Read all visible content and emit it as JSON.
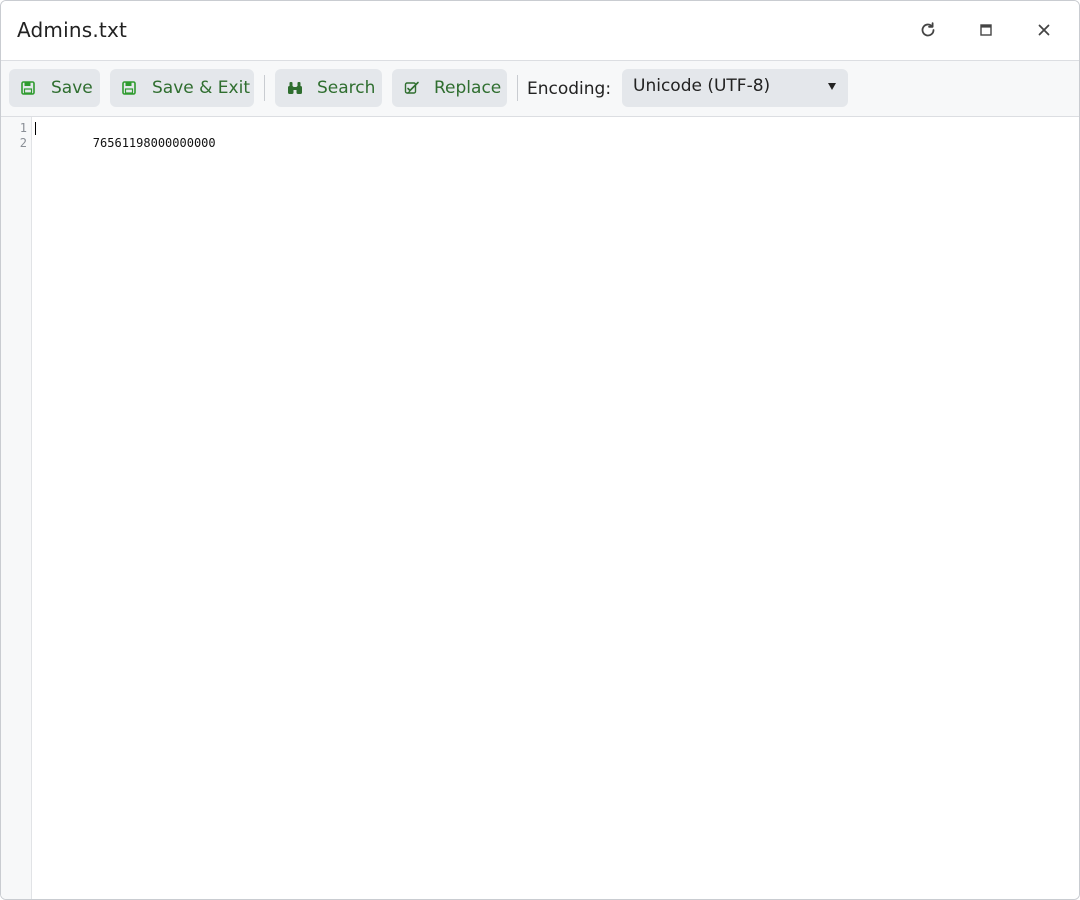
{
  "window": {
    "title": "Admins.txt",
    "controls": [
      "refresh-icon",
      "maximize-icon",
      "close-icon"
    ]
  },
  "toolbar": {
    "save_label": "Save",
    "save_exit_label": "Save & Exit",
    "search_label": "Search",
    "replace_label": "Replace",
    "encoding_label": "Encoding:",
    "encoding_value": "Unicode (UTF-8)",
    "accent_color": "#2f6e2f"
  },
  "editor": {
    "line_numbers": [
      "1",
      "2"
    ],
    "lines": [
      "76561198000000000",
      ""
    ]
  }
}
